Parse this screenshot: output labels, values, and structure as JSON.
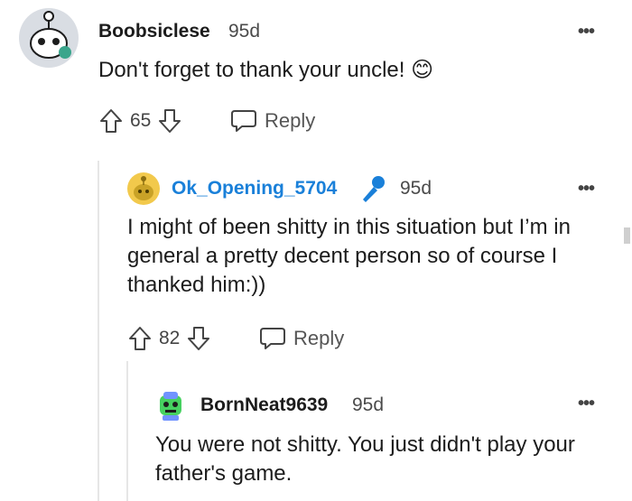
{
  "comments": [
    {
      "username": "Boobsiclese",
      "age": "95d",
      "text": "Don't forget to thank your uncle! 😊",
      "votes": "65",
      "reply_label": "Reply"
    },
    {
      "username": "Ok_Opening_5704",
      "age": "95d",
      "text": "I might of been shitty in this situation but I’m in general a pretty decent person so of course I thanked him:))",
      "votes": "82",
      "reply_label": "Reply",
      "is_op": true
    },
    {
      "username": "BornNeat9639",
      "age": "95d",
      "text": "You were not shitty. You just didn't play your father's game."
    }
  ],
  "menu_glyph": "•••",
  "colors": {
    "op_username": "#1a80d9",
    "thread_line": "#e6e6e6",
    "text": "#1c1c1c",
    "muted": "#4a4a4a"
  }
}
